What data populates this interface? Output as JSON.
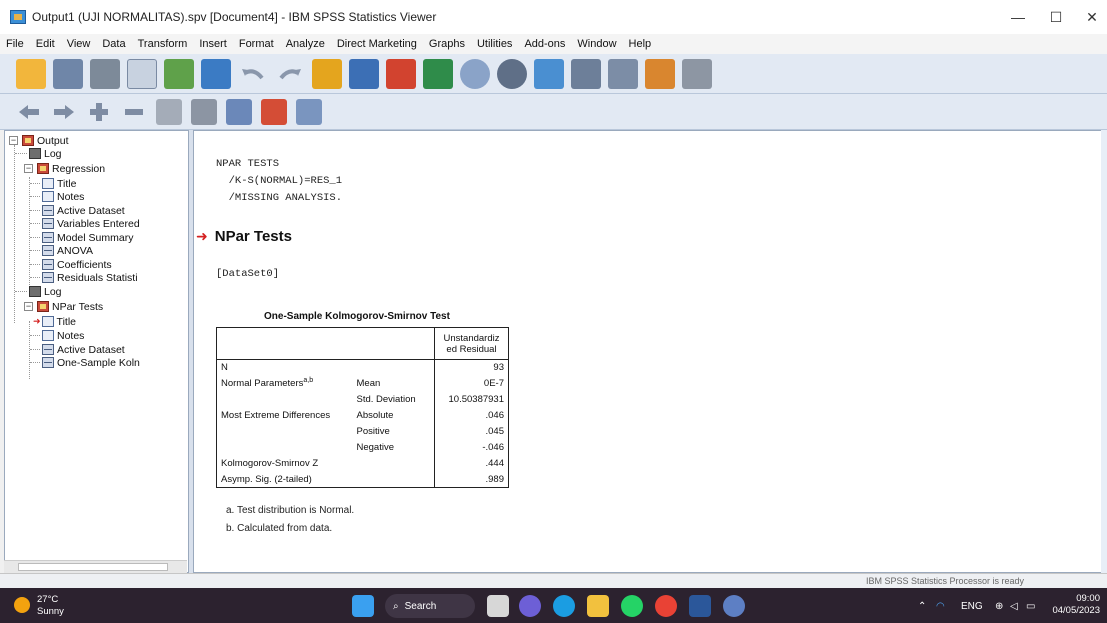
{
  "window": {
    "title": "Output1 (UJI NORMALITAS).spv [Document4] - IBM SPSS Statistics Viewer",
    "minimize": "—",
    "maximize": "☐",
    "close": "✕"
  },
  "menu": [
    "File",
    "Edit",
    "View",
    "Data",
    "Transform",
    "Insert",
    "Format",
    "Analyze",
    "Direct Marketing",
    "Graphs",
    "Utilities",
    "Add-ons",
    "Window",
    "Help"
  ],
  "outline": {
    "root": "Output",
    "log1": "Log",
    "regression": "Regression",
    "reg_items": [
      "Title",
      "Notes",
      "Active Dataset",
      "Variables Entered",
      "Model Summary",
      "ANOVA",
      "Coefficients",
      "Residuals Statisti"
    ],
    "log2": "Log",
    "npar": "NPar Tests",
    "npar_items": [
      "Title",
      "Notes",
      "Active Dataset",
      "One-Sample Koln"
    ]
  },
  "syntax": {
    "line1": "NPAR TESTS",
    "line2": "  /K-S(NORMAL)=RES_1",
    "line3": "  /MISSING ANALYSIS."
  },
  "heading": "NPar Tests",
  "dataset": "[DataSet0]",
  "table": {
    "title": "One-Sample Kolmogorov-Smirnov Test",
    "col_header_1": "Unstandardiz",
    "col_header_2": "ed Residual",
    "rows": [
      {
        "label": "N",
        "sub": "",
        "value": "93"
      },
      {
        "label": "Normal Parameters",
        "sup": "a,b",
        "sub": "Mean",
        "value": "0E-7"
      },
      {
        "label": "",
        "sub": "Std. Deviation",
        "value": "10.50387931"
      },
      {
        "label": "Most Extreme Differences",
        "sub": "Absolute",
        "value": ".046"
      },
      {
        "label": "",
        "sub": "Positive",
        "value": ".045"
      },
      {
        "label": "",
        "sub": "Negative",
        "value": "-.046"
      },
      {
        "label": "Kolmogorov-Smirnov Z",
        "sub": "",
        "value": ".444"
      },
      {
        "label": "Asymp. Sig. (2-tailed)",
        "sub": "",
        "value": ".989"
      }
    ],
    "footnote_a": "a. Test distribution is Normal.",
    "footnote_b": "b. Calculated from data."
  },
  "status": "IBM SPSS Statistics Processor is ready",
  "taskbar": {
    "temp": "27°C",
    "weather": "Sunny",
    "search": "Search",
    "lang": "ENG",
    "time": "09:00",
    "date": "04/05/2023"
  },
  "colors": {
    "toolbar_bg": "#e2e9f3",
    "heading_arrow": "#d42020",
    "taskbar_bg": "#2c222f"
  }
}
